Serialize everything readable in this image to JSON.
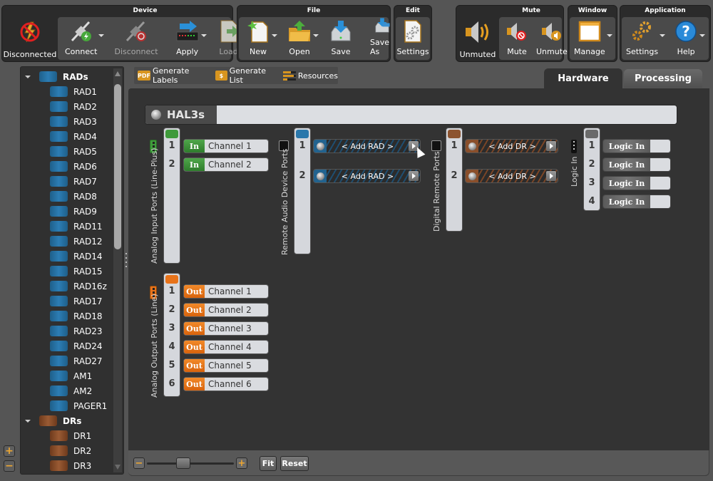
{
  "ribbon": {
    "status": {
      "label": "Disconnected",
      "icon": "disconnected-icon"
    },
    "device": {
      "title": "Device",
      "buttons": [
        {
          "label": "Connect",
          "icon": "connect-plug-icon",
          "enabled": true,
          "dropdown": true
        },
        {
          "label": "Disconnect",
          "icon": "disconnect-plug-icon",
          "enabled": false,
          "dropdown": false
        },
        {
          "label": "Apply",
          "icon": "apply-icon",
          "enabled": true,
          "dropdown": true
        },
        {
          "label": "Load",
          "icon": "load-icon",
          "enabled": false,
          "dropdown": true
        }
      ]
    },
    "file": {
      "title": "File",
      "buttons": [
        {
          "label": "New",
          "icon": "new-file-icon",
          "dropdown": true
        },
        {
          "label": "Open",
          "icon": "open-folder-icon",
          "dropdown": true
        },
        {
          "label": "Save",
          "icon": "save-icon",
          "dropdown": false
        },
        {
          "label": "Save As",
          "icon": "save-as-icon",
          "dropdown": false
        }
      ]
    },
    "edit": {
      "title": "Edit",
      "buttons": [
        {
          "label": "Settings",
          "icon": "settings-file-icon"
        }
      ]
    },
    "mute": {
      "title": "Mute",
      "status": {
        "label": "Unmuted",
        "icon": "speaker-icon"
      },
      "buttons": [
        {
          "label": "Mute",
          "icon": "mute-icon"
        },
        {
          "label": "Unmute",
          "icon": "unmute-icon"
        }
      ]
    },
    "window": {
      "title": "Window",
      "buttons": [
        {
          "label": "Manage",
          "icon": "window-icon",
          "dropdown": true
        }
      ]
    },
    "application": {
      "title": "Application",
      "buttons": [
        {
          "label": "Settings",
          "icon": "gears-icon",
          "dropdown": true
        },
        {
          "label": "Help",
          "icon": "help-icon",
          "dropdown": true
        }
      ]
    }
  },
  "tree": {
    "groups": [
      {
        "label": "RADs",
        "color": "#2a77ab",
        "items": [
          "RAD1",
          "RAD2",
          "RAD3",
          "RAD4",
          "RAD5",
          "RAD6",
          "RAD7",
          "RAD8",
          "RAD9",
          "RAD11",
          "RAD12",
          "RAD14",
          "RAD15",
          "RAD16z",
          "RAD17",
          "RAD18",
          "RAD23",
          "RAD24",
          "RAD27",
          "AM1",
          "AM2",
          "PAGER1"
        ]
      },
      {
        "label": "DRs",
        "color": "#8c532f",
        "items": [
          "DR1",
          "DR2",
          "DR3"
        ]
      }
    ],
    "zoom_in": "+",
    "zoom_out": "−"
  },
  "toolbar": {
    "items": [
      {
        "label": "Generate Labels",
        "icon": "pdf-icon",
        "icon_text": "PDF"
      },
      {
        "label": "Generate List",
        "icon": "list-icon",
        "icon_text": "$"
      },
      {
        "label": "Resources",
        "icon": "resources-icon",
        "icon_text": ""
      }
    ]
  },
  "tabs": [
    {
      "label": "Hardware",
      "active": true
    },
    {
      "label": "Processing",
      "active": false
    }
  ],
  "device": {
    "name": "HAL3s",
    "sections": {
      "analog_in": {
        "label": "Analog Input Ports (Line-Plus)",
        "color": "#3f9a3b",
        "tag": "In",
        "ports": [
          {
            "num": "1",
            "name": "Channel 1"
          },
          {
            "num": "2",
            "name": "Channel 2"
          }
        ]
      },
      "analog_out": {
        "label": "Analog Output Ports (Line)",
        "color": "#e8731a",
        "tag": "Out",
        "ports": [
          {
            "num": "1",
            "name": "Channel 1"
          },
          {
            "num": "2",
            "name": "Channel 2"
          },
          {
            "num": "3",
            "name": "Channel 3"
          },
          {
            "num": "4",
            "name": "Channel 4"
          },
          {
            "num": "5",
            "name": "Channel 5"
          },
          {
            "num": "6",
            "name": "Channel 6"
          }
        ]
      },
      "rad_ports": {
        "label": "Remote Audio Device Ports",
        "color": "#2a77ab",
        "ports": [
          {
            "num": "1",
            "slot": "< Add RAD >"
          },
          {
            "num": "2",
            "slot": "< Add RAD >"
          }
        ]
      },
      "dr_ports": {
        "label": "Digital Remote Ports",
        "color": "#8c532f",
        "ports": [
          {
            "num": "1",
            "slot": "< Add DR >"
          },
          {
            "num": "2",
            "slot": "< Add DR >"
          }
        ]
      },
      "logic_in": {
        "label": "Logic In",
        "color": "#6a6a6a",
        "ports": [
          {
            "num": "1",
            "name": "Logic In"
          },
          {
            "num": "2",
            "name": "Logic In"
          },
          {
            "num": "3",
            "name": "Logic In"
          },
          {
            "num": "4",
            "name": "Logic In"
          }
        ]
      }
    }
  },
  "bottom": {
    "zoom_out": "−",
    "zoom_in": "+",
    "zoom_level": 0.4,
    "fit_label": "Fit",
    "reset_label": "Reset"
  }
}
